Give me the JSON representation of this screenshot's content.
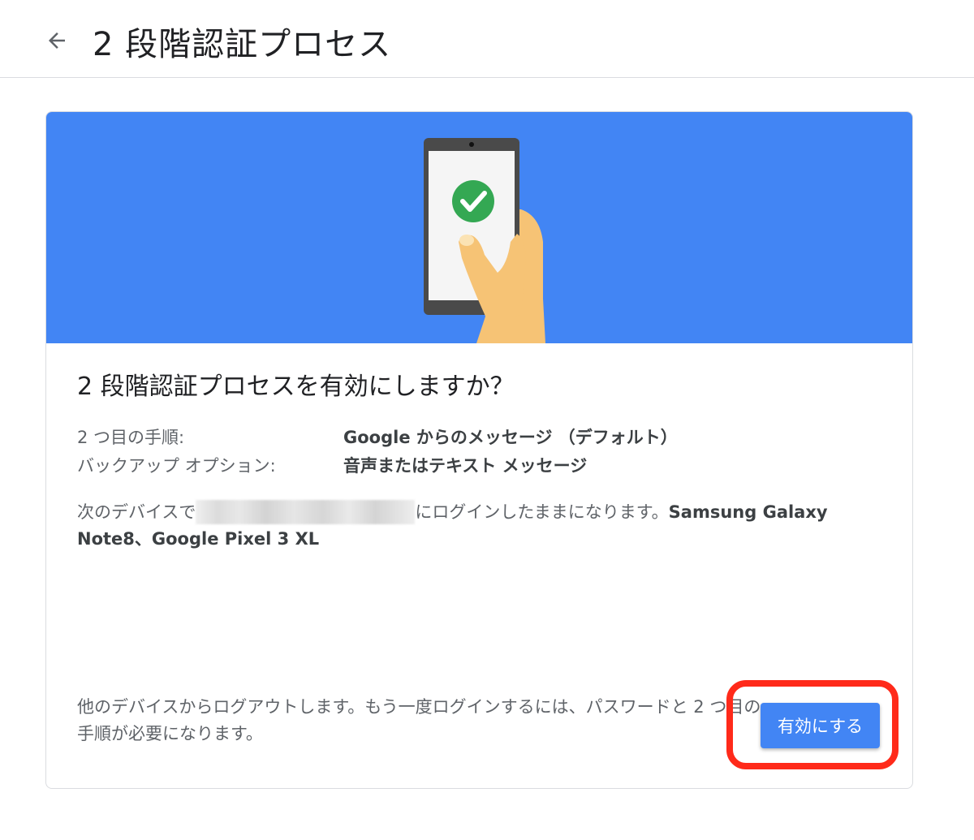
{
  "header": {
    "title": "2 段階認証プロセス"
  },
  "dialog": {
    "title": "2 段階認証プロセスを有効にしますか？",
    "rows": [
      {
        "label": "2 つ目の手順:",
        "value": "Google からのメッセージ （デフォルト）"
      },
      {
        "label": "バックアップ オプション:",
        "value": "音声またはテキスト メッセージ"
      }
    ],
    "device_para": {
      "prefix": "次のデバイスで",
      "middle": "にログインしたままになります。",
      "device1": "Samsung Galaxy",
      "device2": "Note8、Google Pixel 3 XL"
    },
    "logout_para_line1": "他のデバイスからログアウトします。もう一度ログインするには、パスワードと 2 つ目の",
    "logout_para_line2": "手順が必要になります。",
    "enable_button": "有効にする"
  },
  "colors": {
    "banner": "#4285f4",
    "button": "#4285f4",
    "highlight": "#ff2a1a",
    "check": "#34a853"
  }
}
